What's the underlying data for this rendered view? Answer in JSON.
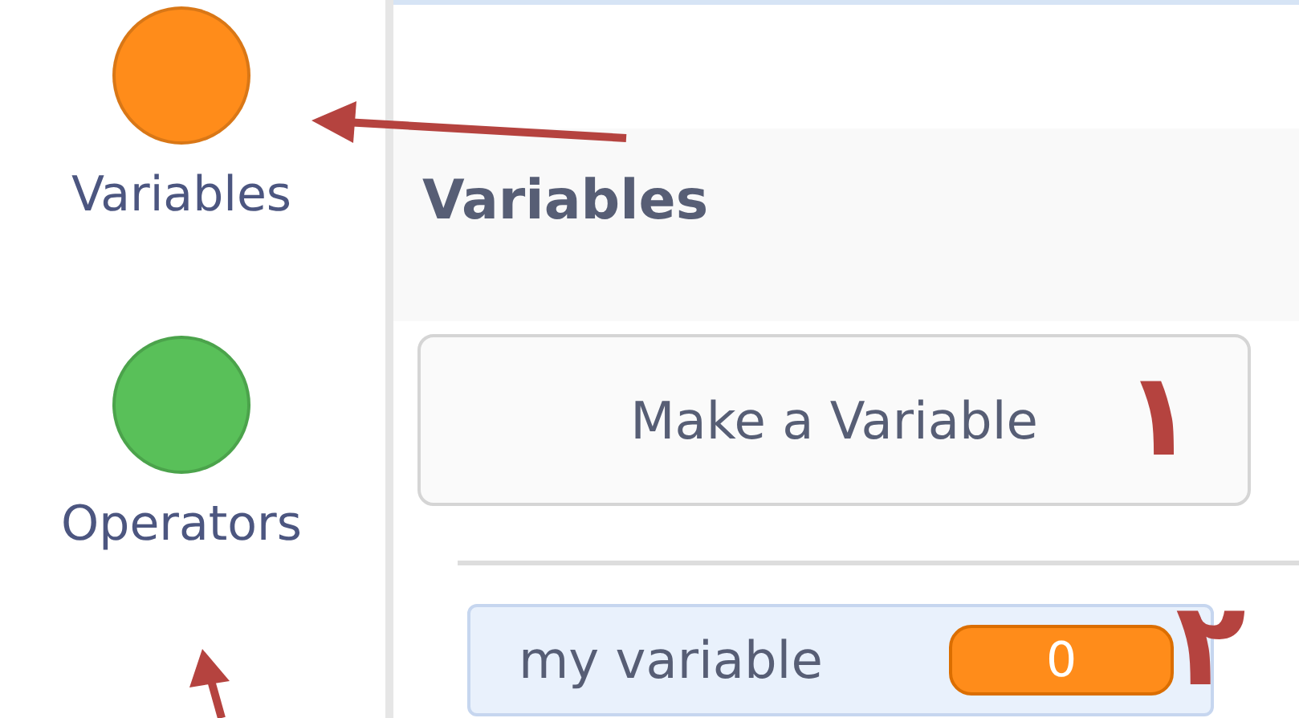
{
  "categories": [
    {
      "label": "Variables",
      "color": "#ff8c1a"
    },
    {
      "label": "Operators",
      "color": "#59c059"
    }
  ],
  "palette": {
    "heading": "Variables",
    "make_button": "Make a Variable",
    "variables": [
      {
        "name": "my variable",
        "value": "0"
      }
    ]
  },
  "annotations": [
    {
      "kind": "numeral",
      "text": "١"
    },
    {
      "kind": "numeral",
      "text": "٢"
    }
  ]
}
